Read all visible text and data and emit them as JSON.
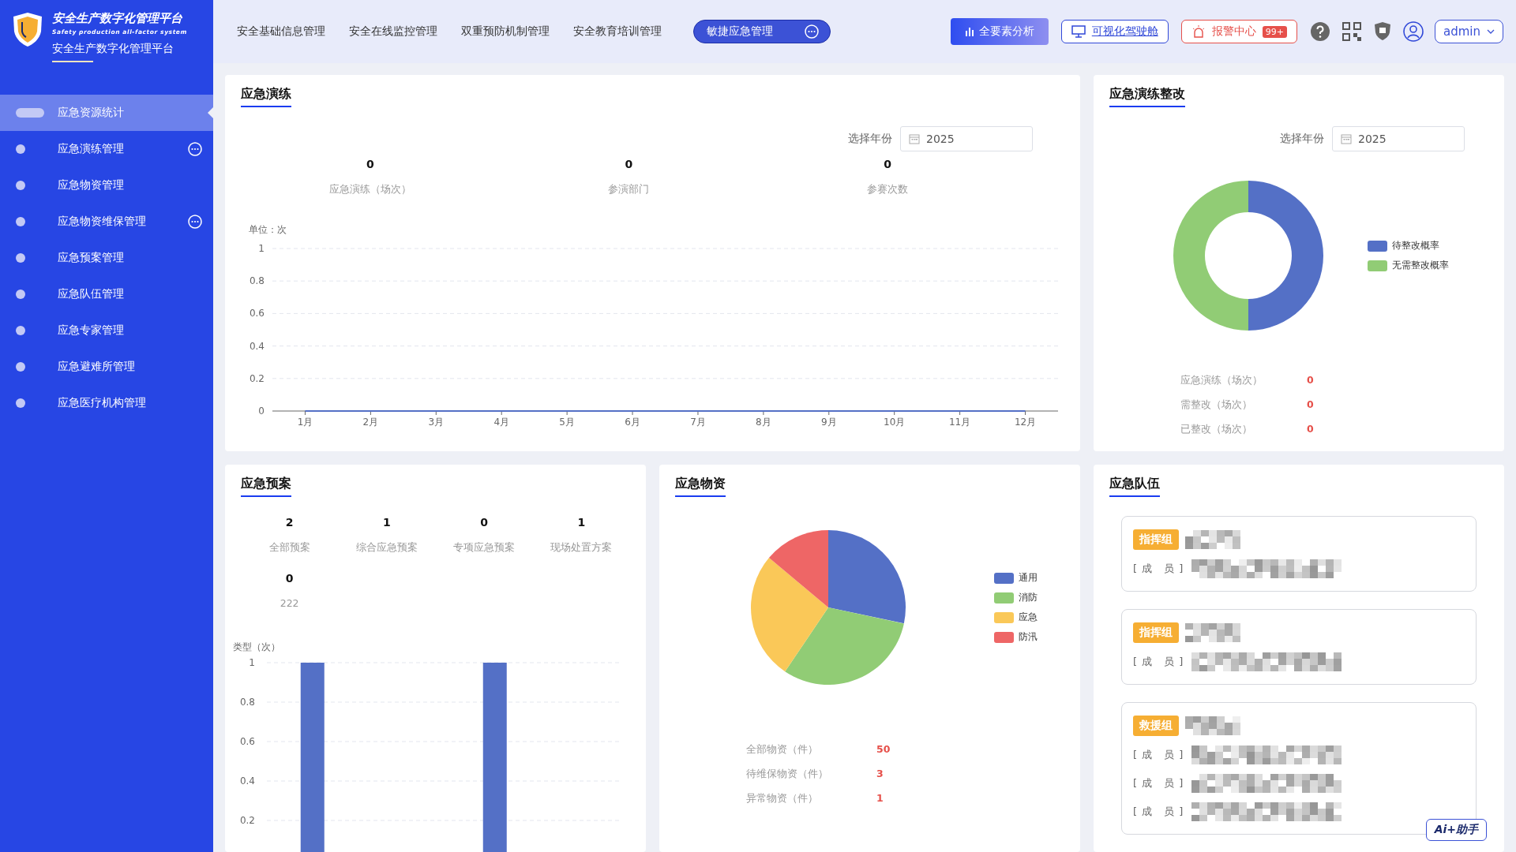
{
  "brand": {
    "title": "安全生产数字化管理平台",
    "subtitle_en": "Safety production all-factor system",
    "subtitle": "安全生产数字化管理平台"
  },
  "sidebar": {
    "items": [
      {
        "label": "应急资源统计",
        "selected": true,
        "has_submenu": false
      },
      {
        "label": "应急演练管理",
        "selected": false,
        "has_submenu": true
      },
      {
        "label": "应急物资管理",
        "selected": false,
        "has_submenu": false
      },
      {
        "label": "应急物资维保管理",
        "selected": false,
        "has_submenu": true
      },
      {
        "label": "应急预案管理",
        "selected": false,
        "has_submenu": false
      },
      {
        "label": "应急队伍管理",
        "selected": false,
        "has_submenu": false
      },
      {
        "label": "应急专家管理",
        "selected": false,
        "has_submenu": false
      },
      {
        "label": "应急避难所管理",
        "selected": false,
        "has_submenu": false
      },
      {
        "label": "应急医疗机构管理",
        "selected": false,
        "has_submenu": false
      }
    ]
  },
  "nav": {
    "items": [
      {
        "label": "安全基础信息管理",
        "selected": false
      },
      {
        "label": "安全在线监控管理",
        "selected": false
      },
      {
        "label": "双重预防机制管理",
        "selected": false
      },
      {
        "label": "安全教育培训管理",
        "selected": false
      },
      {
        "label": "敏捷应急管理",
        "selected": true
      }
    ]
  },
  "toolbar": {
    "analysis": "全要素分析",
    "cockpit": "可视化驾驶舱",
    "alarm": "报警中心",
    "alarm_badge": "99+",
    "user": "admin"
  },
  "drill": {
    "title": "应急演练",
    "year_label": "选择年份",
    "year": "2025",
    "stats": [
      {
        "value": "0",
        "label": "应急演练（场次）"
      },
      {
        "value": "0",
        "label": "参演部门"
      },
      {
        "value": "0",
        "label": "参赛次数"
      }
    ],
    "chart_data": {
      "type": "line",
      "ylabel": "单位：次",
      "categories": [
        "1月",
        "2月",
        "3月",
        "4月",
        "5月",
        "6月",
        "7月",
        "8月",
        "9月",
        "10月",
        "11月",
        "12月"
      ],
      "values": [
        0,
        0,
        0,
        0,
        0,
        0,
        0,
        0,
        0,
        0,
        0,
        0
      ],
      "ylim": [
        0,
        1
      ],
      "yticks": [
        0,
        0.2,
        0.4,
        0.6,
        0.8,
        1
      ],
      "grid": true
    }
  },
  "rectify": {
    "title": "应急演练整改",
    "year_label": "选择年份",
    "year": "2025",
    "legend": [
      {
        "label": "待整改概率",
        "color": "#5470c6"
      },
      {
        "label": "无需整改概率",
        "color": "#91cc75"
      }
    ],
    "stats": [
      {
        "label": "应急演练（场次）",
        "value": "0"
      },
      {
        "label": "需整改（场次）",
        "value": "0"
      },
      {
        "label": "已整改（场次）",
        "value": "0"
      }
    ]
  },
  "plans": {
    "title": "应急预案",
    "stats": [
      {
        "value": "2",
        "label": "全部预案"
      },
      {
        "value": "1",
        "label": "综合应急预案"
      },
      {
        "value": "0",
        "label": "专项应急预案"
      },
      {
        "value": "1",
        "label": "现场处置方案"
      },
      {
        "value": "0",
        "label": "222"
      }
    ],
    "chart_data": {
      "type": "bar",
      "ylabel": "类型（次）",
      "values": [
        1,
        0,
        1,
        0
      ],
      "ylim": [
        0,
        1
      ],
      "yticks": [
        0.2,
        0.4,
        0.6,
        0.8,
        1
      ],
      "grid": true
    }
  },
  "supplies": {
    "title": "应急物资",
    "legend": [
      {
        "label": "通用",
        "color": "#5470c6"
      },
      {
        "label": "消防",
        "color": "#91cc75"
      },
      {
        "label": "应急",
        "color": "#fac858"
      },
      {
        "label": "防汛",
        "color": "#ee6666"
      }
    ],
    "stats": [
      {
        "label": "全部物资（件）",
        "value": "50"
      },
      {
        "label": "待维保物资（件）",
        "value": "3"
      },
      {
        "label": "异常物资（件）",
        "value": "1"
      }
    ]
  },
  "teams": {
    "title": "应急队伍",
    "groups": [
      {
        "tag": "指挥组",
        "members": [
          "[ 成　员 ]"
        ]
      },
      {
        "tag": "指挥组",
        "members": [
          "[ 成　员 ]"
        ]
      },
      {
        "tag": "救援组",
        "members": [
          "[ 成　员 ]",
          "[ 成　员 ]",
          "[ 成　员 ]"
        ]
      }
    ]
  },
  "assistant": {
    "label": "Ai+助手"
  }
}
